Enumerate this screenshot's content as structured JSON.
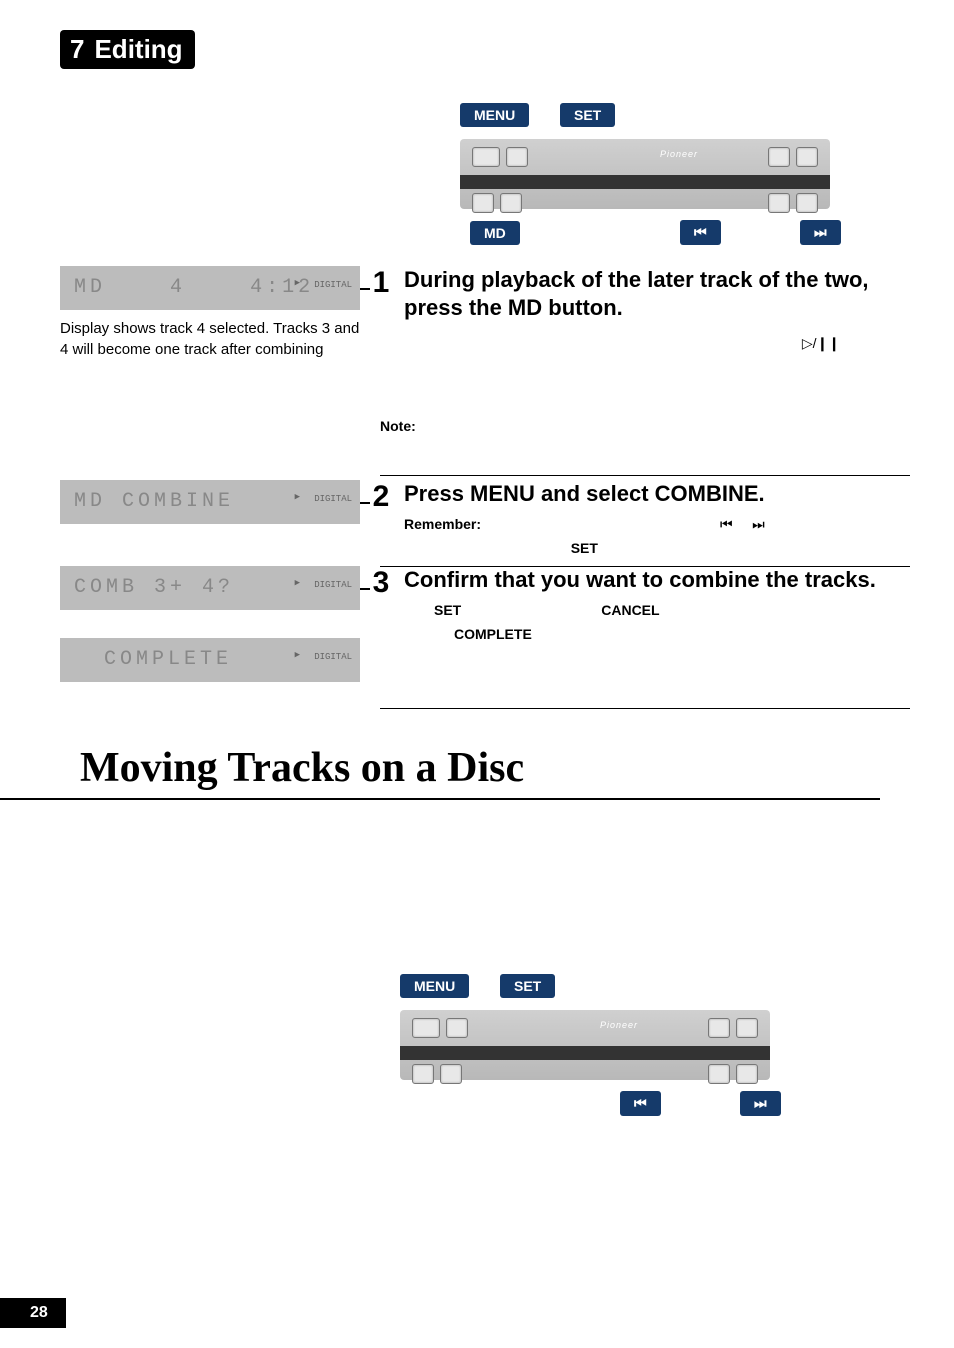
{
  "chapter": {
    "number": "7",
    "title": "Editing"
  },
  "remote_labels": {
    "menu": "MENU",
    "set": "SET",
    "md": "MD",
    "prev": "⏮",
    "next": "⏭"
  },
  "brand": "Pioneer",
  "lcd1": {
    "left": "MD",
    "mid": "4",
    "right": "4:12",
    "badge": "DIGITAL"
  },
  "lcd1_caption": "Display shows track 4 selected. Tracks 3 and 4 will become one track after combining",
  "step1": {
    "num": "1",
    "title": "During playback of the later track of the two, press the MD button.",
    "sub_glyph": "▷/❙❙"
  },
  "note_label": "Note:",
  "lcd2": {
    "text": "MD   COMBINE",
    "badge": "DIGITAL"
  },
  "step2": {
    "num": "2",
    "title": "Press MENU and select COMBINE.",
    "remember_label": "Remember:",
    "glyph_prev": "⏮",
    "glyph_next": "⏭",
    "set_label": "SET"
  },
  "lcd3": {
    "text": "COMB  3+   4?",
    "badge": "DIGITAL"
  },
  "lcd4": {
    "text": "COMPLETE",
    "badge": "DIGITAL"
  },
  "step3": {
    "num": "3",
    "title": "Confirm that you want to combine the tracks.",
    "set_label": "SET",
    "cancel_label": "CANCEL",
    "complete_label": "COMPLETE"
  },
  "section2_title": "Moving Tracks on a Disc",
  "remote_labels2": {
    "menu": "MENU",
    "set": "SET",
    "prev": "⏮",
    "next": "⏭"
  },
  "page_number": "28"
}
